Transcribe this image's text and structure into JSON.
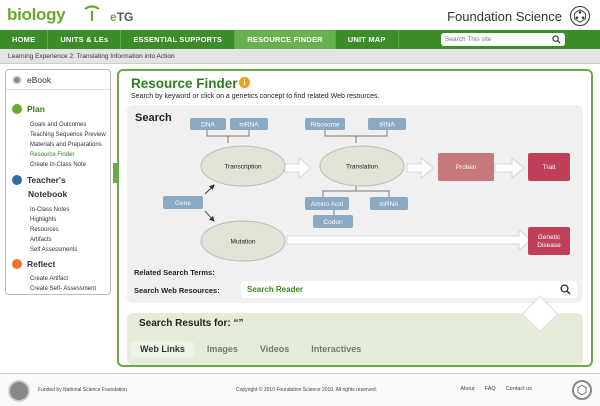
{
  "header": {
    "logo": "biology",
    "product_e": "e",
    "product_rest": "TG",
    "brand": "Foundation Science"
  },
  "nav": {
    "items": [
      "HOME",
      "UNITS & LEs",
      "ESSENTIAL SUPPORTS",
      "RESOURCE FINDER",
      "UNIT MAP"
    ],
    "active": "RESOURCE FINDER",
    "search_placeholder": "Search This site"
  },
  "breadcrumb": "Learning Experience 2: Translating Information into Action",
  "sidebar": {
    "ebook": "eBook",
    "plan": "Plan",
    "plan_items": [
      "Goals and Outcomes",
      "Teaching Sequence Preview",
      "Materials and Preparations",
      "Resource Finder",
      "Create In-Class Note"
    ],
    "active_item": "Resource Finder",
    "notebook_1": "Teacher's",
    "notebook_2": "Notebook",
    "notebook_items": [
      "In-Class Notes",
      "Highlights",
      "Resources",
      "Artifacts",
      "Self Assessments"
    ],
    "reflect": "Reflect",
    "reflect_items": [
      "Create Artifact",
      "Create Self- Assessment"
    ]
  },
  "main": {
    "title": "Resource Finder",
    "subtitle": "Search by keyword or click on a genetics concept to find related Web resources.",
    "search_label": "Search",
    "diagram": {
      "dna": "DNA",
      "mrna_top": "mRNA",
      "ribosome": "Ribosome",
      "trna": "tRNA",
      "transcription": "Transcription",
      "translation": "Translation",
      "protein": "Protein",
      "trait": "Trait",
      "gene": "Gene",
      "amino_acid": "Amino Acid",
      "mrna_bottom": "mRNA",
      "codon": "Codon",
      "mutation": "Mutation",
      "genetic_1": "Genetic",
      "genetic_2": "Disease"
    },
    "related_label": "Related Search Terms:",
    "web_label": "Search Web Resources:",
    "web_value": "Search Reader",
    "results_title": "Search Results for: “”",
    "tabs": [
      "Web Links",
      "Images",
      "Videos",
      "Interactives"
    ],
    "active_tab": "Web Links"
  },
  "footer": {
    "funded": "Funded by National Science Foundation",
    "copyright": "Copyright © 2010 Foundation Science 2010. All rights reserved.",
    "links": [
      "About",
      "FAQ",
      "Contact us"
    ]
  },
  "colors": {
    "nav_green": "#3c8c28",
    "accent_green": "#6aaa46",
    "protein": "#c7787c",
    "trait": "#c0405a",
    "term_blue": "#8aa9c2"
  }
}
